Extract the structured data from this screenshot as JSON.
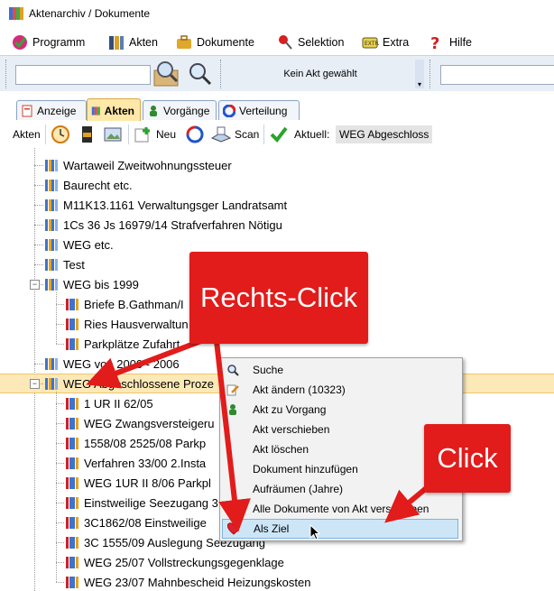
{
  "window": {
    "title": "Aktenarchiv / Dokumente"
  },
  "menu": [
    {
      "label": "Programm",
      "icon": "program-icon"
    },
    {
      "label": "Akten",
      "icon": "akten-icon"
    },
    {
      "label": "Dokumente",
      "icon": "briefcase-icon"
    },
    {
      "label": "Selektion",
      "icon": "pushpin-icon"
    },
    {
      "label": "Extra",
      "icon": "extra-icon"
    },
    {
      "label": "Hilfe",
      "icon": "help-icon"
    }
  ],
  "toolbar1": {
    "status_text": "Kein Akt gewählt"
  },
  "tabs": [
    {
      "label": "Anzeige",
      "active": false
    },
    {
      "label": "Akten",
      "active": true
    },
    {
      "label": "Vorgänge",
      "active": false
    },
    {
      "label": "Verteilung",
      "active": false
    }
  ],
  "toolbar2": {
    "section_label": "Akten",
    "neu_label": "Neu",
    "scan_label": "Scan",
    "aktuell_label": "Aktuell:",
    "aktuell_value": "WEG Abgeschloss"
  },
  "tree": {
    "rows": [
      {
        "label": "Wartaweil Zweitwohnungssteuer",
        "level": 1
      },
      {
        "label": "Baurecht etc.",
        "level": 1
      },
      {
        "label": "M11K13.1161 Verwaltungsger Landratsamt",
        "level": 1
      },
      {
        "label": "1Cs 36 Js 16979/14 Strafverfahren Nötigu",
        "level": 1
      },
      {
        "label": "WEG etc.",
        "level": 1
      },
      {
        "label": "Test",
        "level": 1
      },
      {
        "label": "WEG bis 1999",
        "level": 1,
        "expander": "−"
      },
      {
        "label": "Briefe B.Gathman/I",
        "level": 2
      },
      {
        "label": "Ries Hausverwaltun",
        "level": 2
      },
      {
        "label": "Parkplätze Zufahrt",
        "level": 2
      },
      {
        "label": "WEG von 2000 - 2006",
        "level": 1
      },
      {
        "label": "WEG Abgeschlossene Proze",
        "level": 1,
        "expander": "−",
        "selected": true
      },
      {
        "label": "1 UR II 62/05",
        "level": 2
      },
      {
        "label": "WEG Zwangsversteigeru",
        "level": 2
      },
      {
        "label": "1558/08 2525/08 Parkp",
        "level": 2
      },
      {
        "label": "Verfahren 33/00 2.Insta",
        "level": 2
      },
      {
        "label": "WEG 1UR II 8/06 Parkpl",
        "level": 2
      },
      {
        "label": "Einstweilige Seezugang 3",
        "level": 2
      },
      {
        "label": "3C1862/08 Einstweilige",
        "level": 2
      },
      {
        "label": "3C 1555/09 Auslegung Seezugang",
        "level": 2
      },
      {
        "label": "WEG 25/07 Vollstreckungsgegenklage",
        "level": 2
      },
      {
        "label": "WEG 23/07 Mahnbescheid Heizungskosten",
        "level": 2
      }
    ]
  },
  "context_menu": {
    "items": [
      {
        "label": "Suche",
        "icon": "magnifier-icon"
      },
      {
        "label": "Akt ändern (10323)",
        "icon": "edit-icon"
      },
      {
        "label": "Akt zu Vorgang",
        "icon": "person-icon"
      },
      {
        "label": "Akt verschieben",
        "icon": "move-icon"
      },
      {
        "label": "Akt löschen",
        "icon": "delete-icon"
      },
      {
        "label": "Dokument hinzufügen",
        "icon": ""
      },
      {
        "label": "Aufräumen (Jahre)",
        "icon": ""
      },
      {
        "label": "Alle Dokumente von Akt verschieben",
        "icon": ""
      },
      {
        "label": "Als Ziel",
        "icon": "heart-icon",
        "highlighted": true
      }
    ]
  },
  "annotations": {
    "rechts_click": "Rechts-Click",
    "click": "Click"
  },
  "colors": {
    "callout": "#e21b1b",
    "selection": "#fde9b8",
    "menu_highlight": "#cde6f7"
  }
}
